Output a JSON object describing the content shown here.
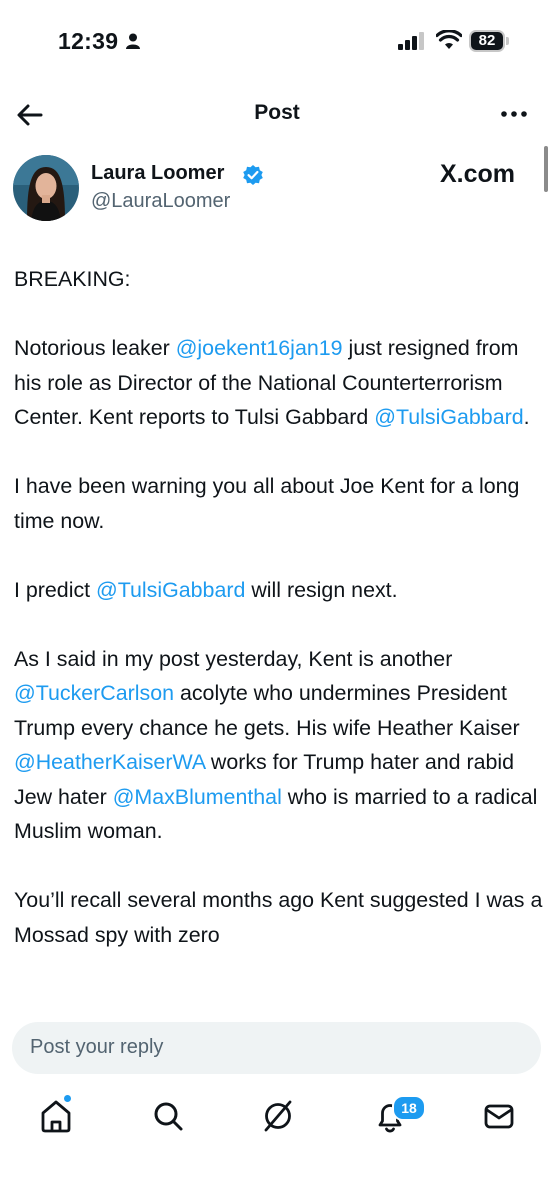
{
  "status_bar": {
    "time": "12:39",
    "battery": "82"
  },
  "header": {
    "title": "Post"
  },
  "author": {
    "name": "Laura Loomer",
    "handle": "@LauraLoomer",
    "watermark": "X.com"
  },
  "post": {
    "p1": "BREAKING:",
    "p2": {
      "t1": "Notorious leaker ",
      "m1": "@joekent16jan19",
      "t2": " just resigned from his role as Director of the National Counterterrorism Center. Kent reports to Tulsi Gabbard ",
      "m2": "@TulsiGabbard",
      "t3": "."
    },
    "p3": "I have been warning you all about Joe Kent for a long time now.",
    "p4": {
      "t1": "I predict ",
      "m1": "@TulsiGabbard",
      "t2": " will resign next."
    },
    "p5": {
      "t1": "As I said in my post yesterday, Kent is another ",
      "m1": "@TuckerCarlson",
      "t2": " acolyte who undermines President Trump every chance he gets. His wife Heather Kaiser ",
      "m2": "@HeatherKaiserWA",
      "t3": " works for Trump hater and rabid Jew hater ",
      "m3": "@MaxBlumenthal",
      "t4": " who is married to a radical Muslim woman."
    },
    "p6": "You’ll recall several months ago Kent suggested I was a Mossad spy with zero"
  },
  "reply": {
    "placeholder": "Post your reply"
  },
  "nav": {
    "notifications_count": "18"
  },
  "colors": {
    "accent": "#1d9bf0",
    "text": "#0f1419",
    "secondary": "#536471"
  }
}
